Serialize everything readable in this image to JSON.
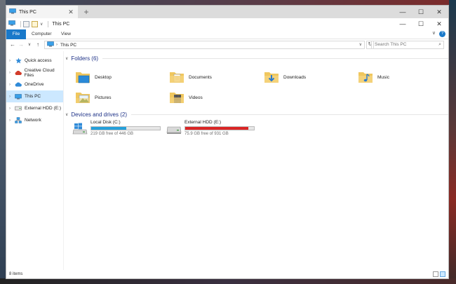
{
  "tab": {
    "title": "This PC",
    "close": "✕",
    "new_tab": "+"
  },
  "window_controls": {
    "minimize": "—",
    "maximize": "☐",
    "close": "✕"
  },
  "titlebar": {
    "title": "This PC",
    "qat_dropdown": "∨"
  },
  "ribbon": {
    "tabs": [
      {
        "label": "File",
        "active": true
      },
      {
        "label": "Computer"
      },
      {
        "label": "View"
      }
    ],
    "expand": "∨",
    "help": "?"
  },
  "address": {
    "back": "←",
    "forward": "→",
    "recent": "∨",
    "up": "↑",
    "path": "This PC",
    "refresh": "↻",
    "search_placeholder": "Search This PC",
    "search_icon": "⌕"
  },
  "sidebar": {
    "items": [
      {
        "label": "Quick access",
        "icon": "star-icon",
        "expandable": true
      },
      {
        "label": "Creative Cloud Files",
        "icon": "creative-cloud-icon",
        "expandable": true
      },
      {
        "label": "OneDrive",
        "icon": "cloud-icon",
        "expandable": true
      },
      {
        "label": "This PC",
        "icon": "computer-icon",
        "expandable": true,
        "selected": true
      },
      {
        "label": "External HDD (E:)",
        "icon": "drive-icon",
        "expandable": true
      },
      {
        "label": "Network",
        "icon": "network-icon",
        "expandable": true
      }
    ]
  },
  "folders": {
    "heading": "Folders (6)",
    "items": [
      {
        "label": "Desktop",
        "icon": "desktop-folder-icon"
      },
      {
        "label": "Documents",
        "icon": "documents-folder-icon"
      },
      {
        "label": "Downloads",
        "icon": "downloads-folder-icon"
      },
      {
        "label": "Music",
        "icon": "music-folder-icon"
      },
      {
        "label": "Pictures",
        "icon": "pictures-folder-icon"
      },
      {
        "label": "Videos",
        "icon": "videos-folder-icon"
      }
    ]
  },
  "drives": {
    "heading": "Devices and drives (2)",
    "items": [
      {
        "label": "Local Disk (C:)",
        "free": "219 GB free of 446 GB",
        "used_fraction": 0.51,
        "bar_color": "#26a0da",
        "icon": "windows-drive-icon"
      },
      {
        "label": "External HDD (E:)",
        "free": "75.9 GB free of 931 GB",
        "used_fraction": 0.92,
        "bar_color": "#da2626",
        "icon": "external-drive-icon"
      }
    ]
  },
  "status": {
    "item_count": "8 items"
  },
  "colors": {
    "accent": "#1979ca",
    "selection": "#cce8ff",
    "group_heading": "#1e3287"
  }
}
